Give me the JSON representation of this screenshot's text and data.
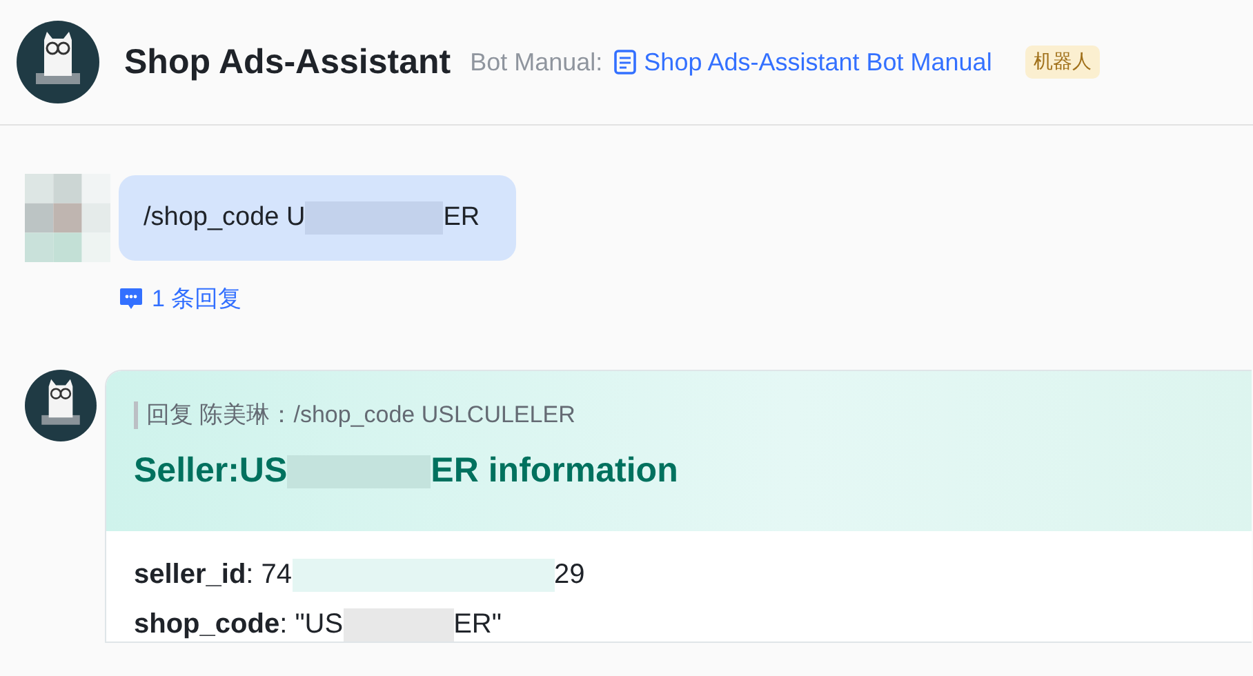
{
  "header": {
    "title": "Shop Ads-Assistant",
    "manual_label": "Bot Manual:",
    "manual_link": "Shop Ads-Assistant Bot Manual",
    "badge": "机器人"
  },
  "user_message": {
    "before": "/shop_code U",
    "after": "ER",
    "reply_count": "1 条回复"
  },
  "bot_card": {
    "quote": "回复 陈美琳：/shop_code USLCULELER",
    "title_before": "Seller:US",
    "title_after": "ER information",
    "fields": [
      {
        "before": "**seller_id**: 74",
        "after": "29"
      },
      {
        "before": "**shop_code**: \"US",
        "after": "ER\""
      }
    ]
  }
}
